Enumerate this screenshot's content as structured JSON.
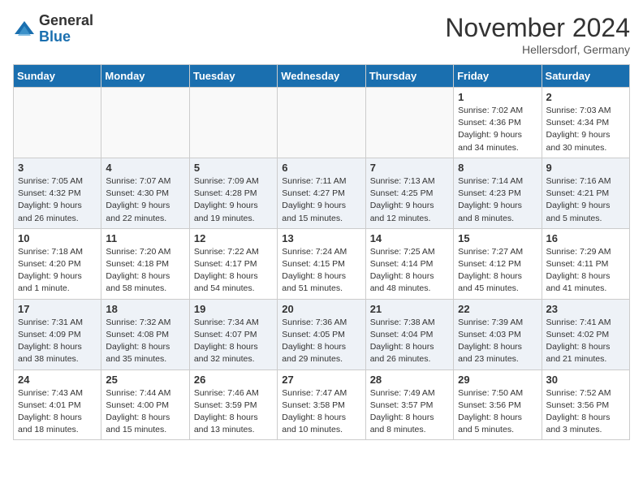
{
  "header": {
    "logo_general": "General",
    "logo_blue": "Blue",
    "month_title": "November 2024",
    "location": "Hellersdorf, Germany"
  },
  "weekdays": [
    "Sunday",
    "Monday",
    "Tuesday",
    "Wednesday",
    "Thursday",
    "Friday",
    "Saturday"
  ],
  "weeks": [
    [
      {
        "day": "",
        "info": ""
      },
      {
        "day": "",
        "info": ""
      },
      {
        "day": "",
        "info": ""
      },
      {
        "day": "",
        "info": ""
      },
      {
        "day": "",
        "info": ""
      },
      {
        "day": "1",
        "info": "Sunrise: 7:02 AM\nSunset: 4:36 PM\nDaylight: 9 hours\nand 34 minutes."
      },
      {
        "day": "2",
        "info": "Sunrise: 7:03 AM\nSunset: 4:34 PM\nDaylight: 9 hours\nand 30 minutes."
      }
    ],
    [
      {
        "day": "3",
        "info": "Sunrise: 7:05 AM\nSunset: 4:32 PM\nDaylight: 9 hours\nand 26 minutes."
      },
      {
        "day": "4",
        "info": "Sunrise: 7:07 AM\nSunset: 4:30 PM\nDaylight: 9 hours\nand 22 minutes."
      },
      {
        "day": "5",
        "info": "Sunrise: 7:09 AM\nSunset: 4:28 PM\nDaylight: 9 hours\nand 19 minutes."
      },
      {
        "day": "6",
        "info": "Sunrise: 7:11 AM\nSunset: 4:27 PM\nDaylight: 9 hours\nand 15 minutes."
      },
      {
        "day": "7",
        "info": "Sunrise: 7:13 AM\nSunset: 4:25 PM\nDaylight: 9 hours\nand 12 minutes."
      },
      {
        "day": "8",
        "info": "Sunrise: 7:14 AM\nSunset: 4:23 PM\nDaylight: 9 hours\nand 8 minutes."
      },
      {
        "day": "9",
        "info": "Sunrise: 7:16 AM\nSunset: 4:21 PM\nDaylight: 9 hours\nand 5 minutes."
      }
    ],
    [
      {
        "day": "10",
        "info": "Sunrise: 7:18 AM\nSunset: 4:20 PM\nDaylight: 9 hours\nand 1 minute."
      },
      {
        "day": "11",
        "info": "Sunrise: 7:20 AM\nSunset: 4:18 PM\nDaylight: 8 hours\nand 58 minutes."
      },
      {
        "day": "12",
        "info": "Sunrise: 7:22 AM\nSunset: 4:17 PM\nDaylight: 8 hours\nand 54 minutes."
      },
      {
        "day": "13",
        "info": "Sunrise: 7:24 AM\nSunset: 4:15 PM\nDaylight: 8 hours\nand 51 minutes."
      },
      {
        "day": "14",
        "info": "Sunrise: 7:25 AM\nSunset: 4:14 PM\nDaylight: 8 hours\nand 48 minutes."
      },
      {
        "day": "15",
        "info": "Sunrise: 7:27 AM\nSunset: 4:12 PM\nDaylight: 8 hours\nand 45 minutes."
      },
      {
        "day": "16",
        "info": "Sunrise: 7:29 AM\nSunset: 4:11 PM\nDaylight: 8 hours\nand 41 minutes."
      }
    ],
    [
      {
        "day": "17",
        "info": "Sunrise: 7:31 AM\nSunset: 4:09 PM\nDaylight: 8 hours\nand 38 minutes."
      },
      {
        "day": "18",
        "info": "Sunrise: 7:32 AM\nSunset: 4:08 PM\nDaylight: 8 hours\nand 35 minutes."
      },
      {
        "day": "19",
        "info": "Sunrise: 7:34 AM\nSunset: 4:07 PM\nDaylight: 8 hours\nand 32 minutes."
      },
      {
        "day": "20",
        "info": "Sunrise: 7:36 AM\nSunset: 4:05 PM\nDaylight: 8 hours\nand 29 minutes."
      },
      {
        "day": "21",
        "info": "Sunrise: 7:38 AM\nSunset: 4:04 PM\nDaylight: 8 hours\nand 26 minutes."
      },
      {
        "day": "22",
        "info": "Sunrise: 7:39 AM\nSunset: 4:03 PM\nDaylight: 8 hours\nand 23 minutes."
      },
      {
        "day": "23",
        "info": "Sunrise: 7:41 AM\nSunset: 4:02 PM\nDaylight: 8 hours\nand 21 minutes."
      }
    ],
    [
      {
        "day": "24",
        "info": "Sunrise: 7:43 AM\nSunset: 4:01 PM\nDaylight: 8 hours\nand 18 minutes."
      },
      {
        "day": "25",
        "info": "Sunrise: 7:44 AM\nSunset: 4:00 PM\nDaylight: 8 hours\nand 15 minutes."
      },
      {
        "day": "26",
        "info": "Sunrise: 7:46 AM\nSunset: 3:59 PM\nDaylight: 8 hours\nand 13 minutes."
      },
      {
        "day": "27",
        "info": "Sunrise: 7:47 AM\nSunset: 3:58 PM\nDaylight: 8 hours\nand 10 minutes."
      },
      {
        "day": "28",
        "info": "Sunrise: 7:49 AM\nSunset: 3:57 PM\nDaylight: 8 hours\nand 8 minutes."
      },
      {
        "day": "29",
        "info": "Sunrise: 7:50 AM\nSunset: 3:56 PM\nDaylight: 8 hours\nand 5 minutes."
      },
      {
        "day": "30",
        "info": "Sunrise: 7:52 AM\nSunset: 3:56 PM\nDaylight: 8 hours\nand 3 minutes."
      }
    ]
  ]
}
